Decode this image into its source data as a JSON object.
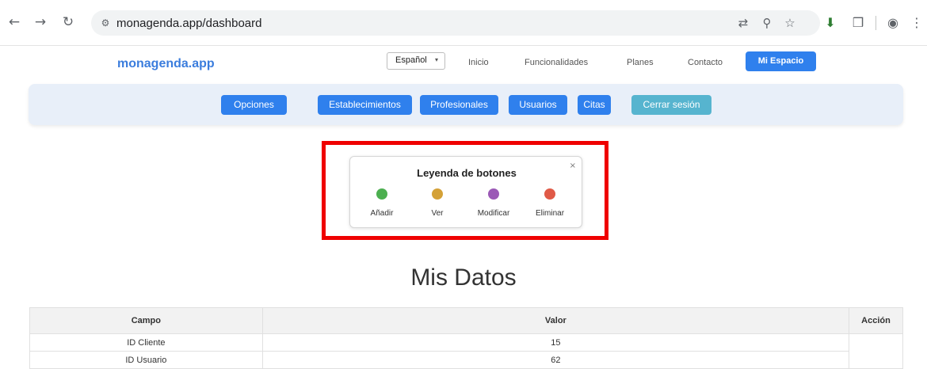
{
  "browser": {
    "url": "monagenda.app/dashboard"
  },
  "header": {
    "brand": "monagenda.app",
    "language": "Español",
    "nav": [
      "Inicio",
      "Funcionalidades",
      "Planes",
      "Contacto"
    ],
    "cta": "Mi Espacio"
  },
  "options": [
    {
      "label": "Opciones",
      "color": "#2f80ed"
    },
    {
      "label": "Establecimientos",
      "color": "#2f80ed"
    },
    {
      "label": "Profesionales",
      "color": "#2f80ed"
    },
    {
      "label": "Usuarios",
      "color": "#2f80ed"
    },
    {
      "label": "Citas",
      "color": "#2f80ed"
    },
    {
      "label": "Cerrar sesión",
      "color": "#56b4cf"
    }
  ],
  "legend": {
    "title": "Leyenda de botones",
    "close": "×",
    "items": [
      {
        "label": "Añadir",
        "color": "#4caf50"
      },
      {
        "label": "Ver",
        "color": "#d4a137"
      },
      {
        "label": "Modificar",
        "color": "#9b59b6"
      },
      {
        "label": "Eliminar",
        "color": "#e05a47"
      }
    ]
  },
  "main": {
    "title": "Mis Datos",
    "table": {
      "headers": [
        "Campo",
        "Valor",
        "Acción"
      ],
      "rows": [
        [
          "ID Cliente",
          "15"
        ],
        [
          "ID Usuario",
          "62"
        ]
      ]
    }
  }
}
